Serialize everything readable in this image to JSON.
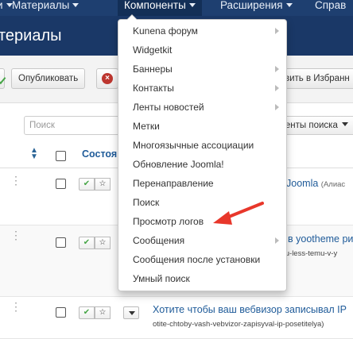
{
  "navbar": {
    "items": [
      {
        "label": "Материалы"
      },
      {
        "label": "Компоненты"
      },
      {
        "label": "Расширения"
      },
      {
        "label": "Справ"
      }
    ],
    "partial_left": "и"
  },
  "page": {
    "title": "териалы"
  },
  "toolbar": {
    "publish_label": "Опубликовать",
    "unpublish_icon": "×",
    "featured_label": "вить в Избранн"
  },
  "filters": {
    "search_placeholder": "Поиск",
    "search_tools_label": "менты поиска"
  },
  "table": {
    "status_header": "Состоя",
    "rows": [
      {
        "title": "Joomla",
        "alias_note": "(Алиас"
      },
      {
        "title": "в yootheme ри",
        "alias": "yu-less-temu-v-y"
      },
      {
        "title": "Хотите чтобы ваш вебвизор записывал IP",
        "alias": "otite-chtoby-vash-vebvizor-zapisyval-ip-posetitelya)"
      }
    ]
  },
  "components_menu": {
    "items": [
      {
        "label": "Kunena форум",
        "submenu": true
      },
      {
        "label": "Widgetkit",
        "submenu": false
      },
      {
        "label": "Баннеры",
        "submenu": true
      },
      {
        "label": "Контакты",
        "submenu": true
      },
      {
        "label": "Ленты новостей",
        "submenu": true
      },
      {
        "label": "Метки",
        "submenu": false
      },
      {
        "label": "Многоязычные ассоциации",
        "submenu": false
      },
      {
        "label": "Обновление Joomla!",
        "submenu": false
      },
      {
        "label": "Перенаправление",
        "submenu": false
      },
      {
        "label": "Поиск",
        "submenu": false
      },
      {
        "label": "Просмотр логов",
        "submenu": false
      },
      {
        "label": "Сообщения",
        "submenu": true
      },
      {
        "label": "Сообщения после установки",
        "submenu": false
      },
      {
        "label": "Умный поиск",
        "submenu": false
      }
    ]
  },
  "colors": {
    "navbar": "#1e3f70",
    "titlebar": "#1a3867",
    "link": "#1f5b99",
    "annotation_arrow": "#e8372b"
  },
  "icons": {
    "sort": "sort-icon",
    "publish": "check-icon",
    "featured": "star-icon",
    "unpublish": "cancel-icon",
    "drag": "drag-handle-icon"
  }
}
